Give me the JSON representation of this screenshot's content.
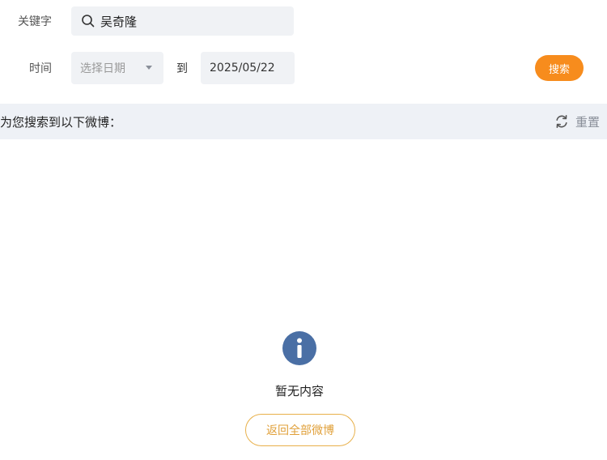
{
  "filters": {
    "keyword_label": "关键字",
    "keyword_value": "吴奇隆",
    "time_label": "时间",
    "date_start_placeholder": "选择日期",
    "to_label": "到",
    "date_end_value": "2025/05/22",
    "search_button_label": "搜索"
  },
  "results": {
    "title": "为您搜索到以下微博：",
    "reset_label": "重置",
    "empty_text": "暂无内容",
    "back_button_label": "返回全部微博"
  },
  "colors": {
    "accent_orange": "#f78c1d",
    "info_blue": "#4a6fa5",
    "outline_gold": "#e8b04a",
    "input_bg": "#f0f2f5",
    "bar_bg": "#eef1f6"
  },
  "icons": {
    "search": "search-icon",
    "reset": "refresh-icon",
    "info": "info-icon",
    "caret": "chevron-down-icon"
  }
}
